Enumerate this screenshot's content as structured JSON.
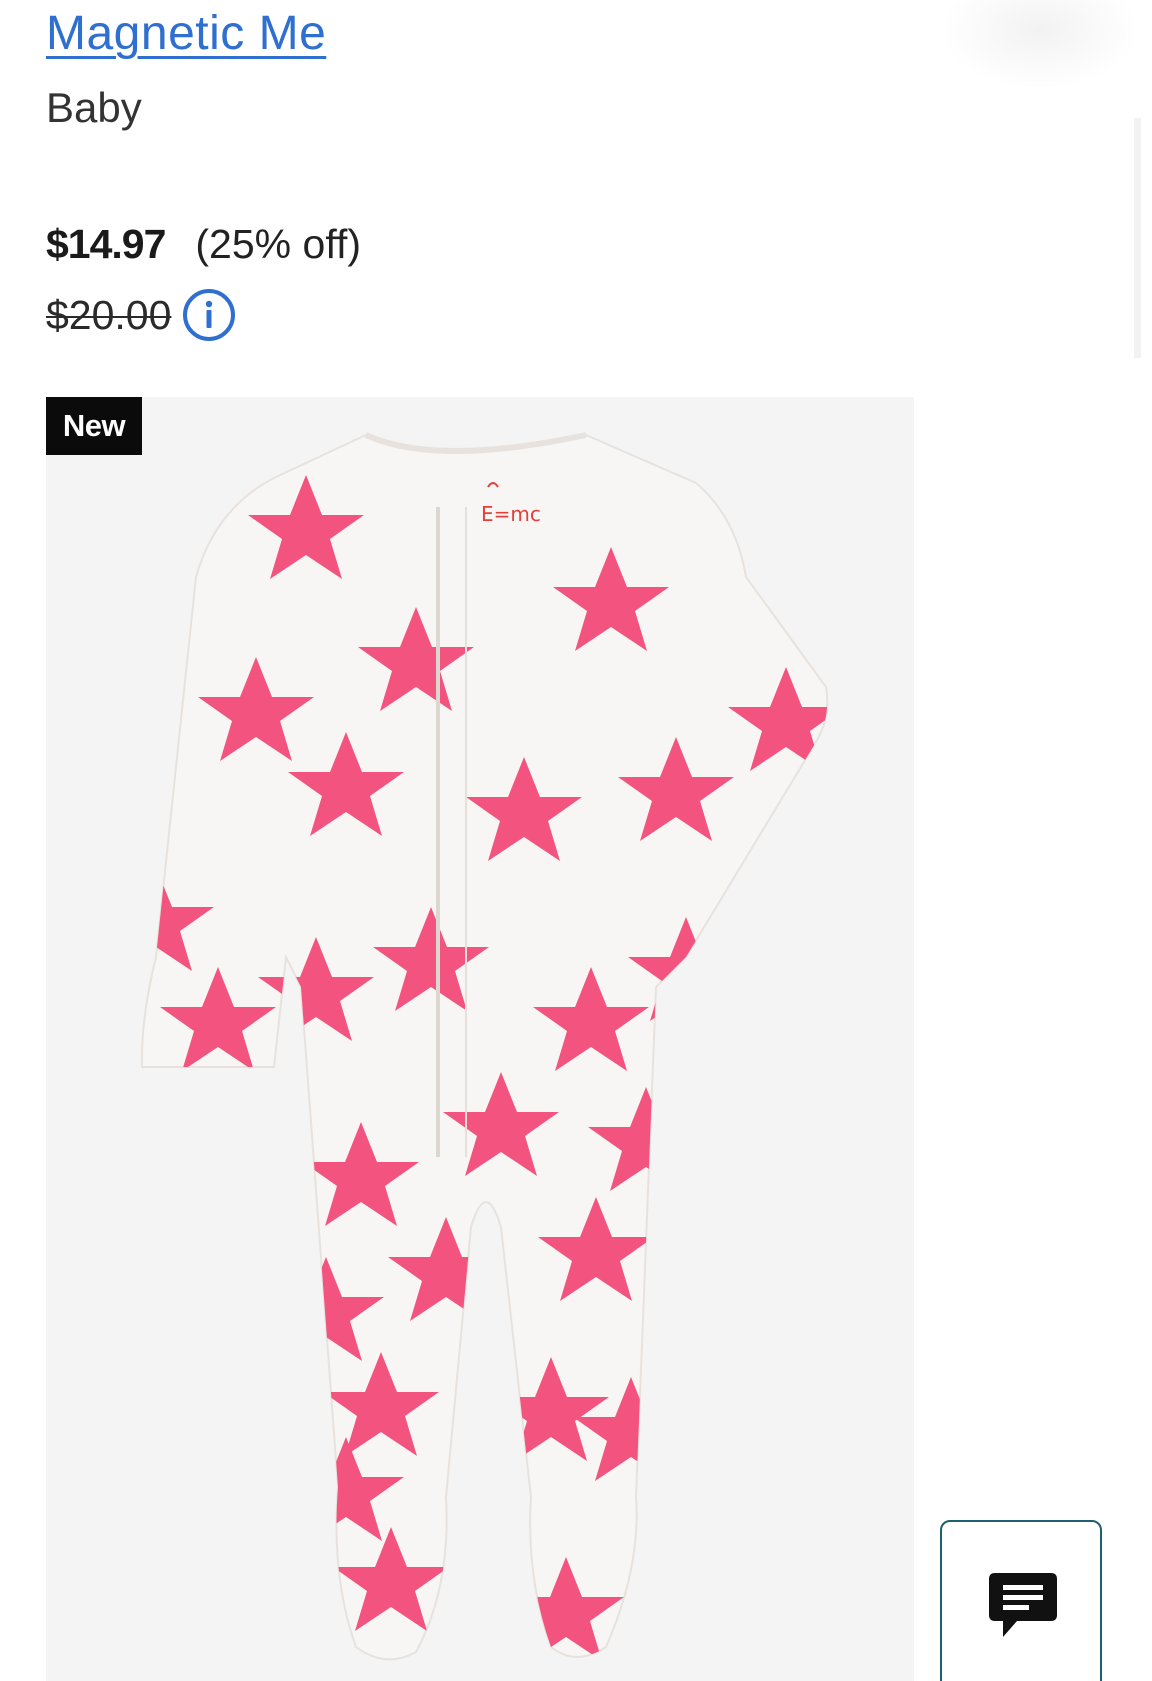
{
  "product": {
    "brand": "Magnetic Me",
    "category": "Baby",
    "price": {
      "sale": "$14.97",
      "discount": "(25% off)",
      "original": "$20.00"
    },
    "badge": "New",
    "image": {
      "logo_text": "E=mc",
      "background_color": "#f4f4f4",
      "garment_color": "#f8f6f4",
      "star_color": "#f2547f"
    }
  },
  "icons": {
    "info": "info-icon",
    "chat": "chat-icon"
  },
  "colors": {
    "link": "#2e6fd0",
    "badge_bg": "#0b0b0b",
    "chat_border": "#1f5f72"
  }
}
